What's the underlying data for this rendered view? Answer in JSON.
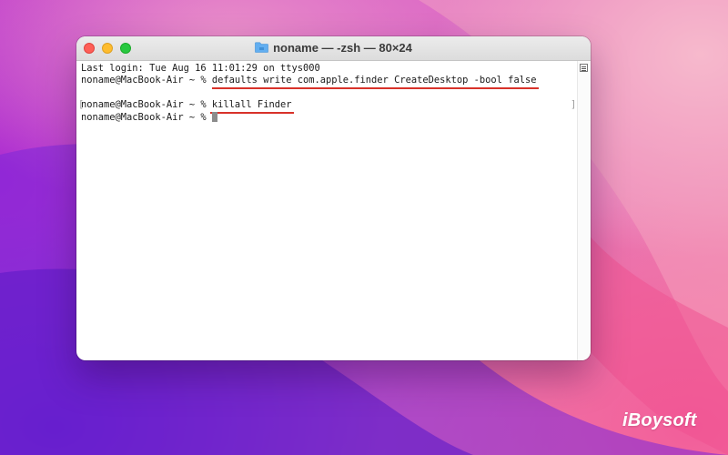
{
  "window": {
    "title": "noname — -zsh — 80×24",
    "title_icon": "folder-icon"
  },
  "terminal": {
    "lines": [
      {
        "text": "Last login: Tue Aug 16 11:01:29 on ttys000"
      },
      {
        "prompt": "noname@MacBook-Air ~ % ",
        "command": "defaults write com.apple.finder CreateDesktop -bool false"
      },
      {
        "prompt": "",
        "command": ""
      },
      {
        "prompt": "noname@MacBook-Air ~ % ",
        "command": "killall Finder"
      },
      {
        "prompt": "noname@MacBook-Air ~ % ",
        "command": ""
      }
    ],
    "bracket_left": "[",
    "bracket_right": "]",
    "underline_color": "#d8322a"
  },
  "watermark": {
    "brand": "iBoysoft"
  }
}
